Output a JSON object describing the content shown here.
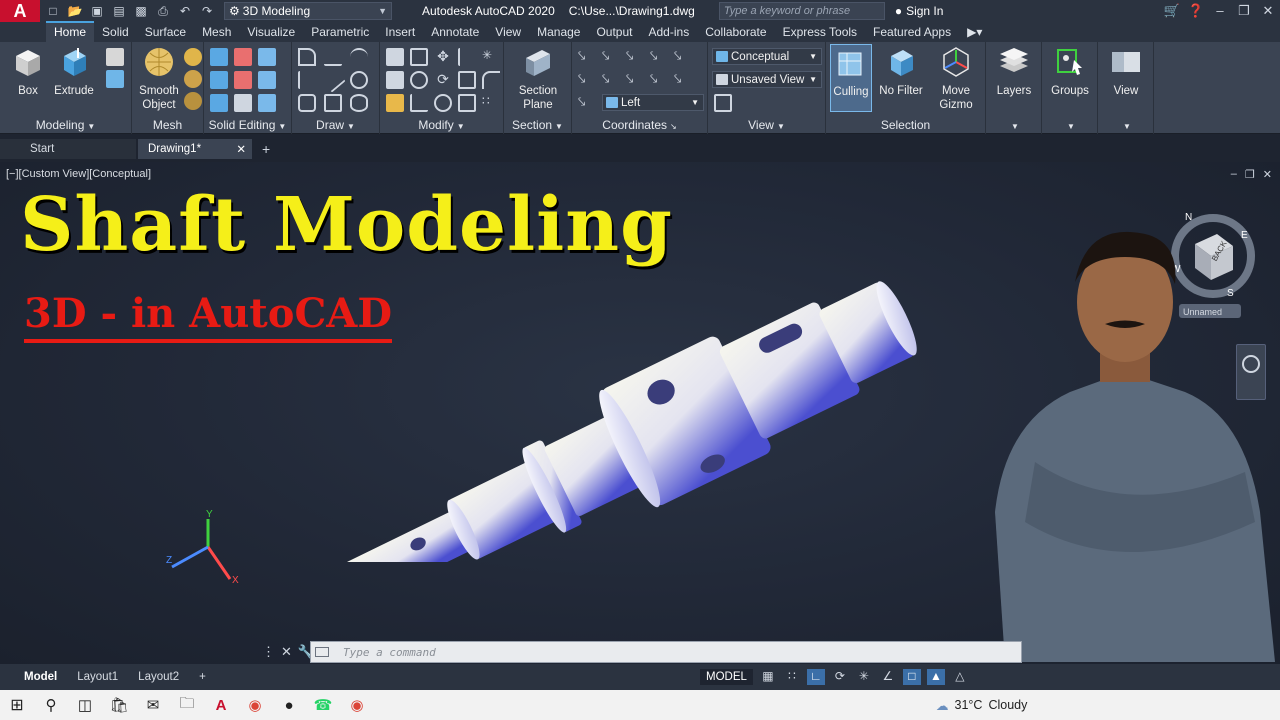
{
  "titlebar": {
    "logo": "A",
    "workspace": "3D Modeling",
    "app_title": "Autodesk AutoCAD 2020",
    "doc_path": "C:\\Use...\\Drawing1.dwg",
    "search_placeholder": "Type a keyword or phrase",
    "sign_in": "Sign In"
  },
  "ribbon_tabs": [
    "Home",
    "Solid",
    "Surface",
    "Mesh",
    "Visualize",
    "Parametric",
    "Insert",
    "Annotate",
    "View",
    "Manage",
    "Output",
    "Add-ins",
    "Collaborate",
    "Express Tools",
    "Featured Apps"
  ],
  "ribbon": {
    "modeling": {
      "title": "Modeling",
      "box": "Box",
      "extrude": "Extrude"
    },
    "mesh": {
      "title": "Mesh",
      "smooth_object": "Smooth Object"
    },
    "solid_editing": {
      "title": "Solid Editing"
    },
    "draw": {
      "title": "Draw"
    },
    "modify": {
      "title": "Modify"
    },
    "section": {
      "title": "Section",
      "section_plane": "Section Plane"
    },
    "coordinates": {
      "title": "Coordinates"
    },
    "view": {
      "title": "View",
      "visual_style": "Conceptual",
      "named_view": "Unsaved View",
      "direction": "Left"
    },
    "selection": {
      "title": "Selection",
      "culling": "Culling",
      "no_filter": "No Filter",
      "move_gizmo": "Move Gizmo"
    },
    "layers": {
      "label": "Layers"
    },
    "groups": {
      "label": "Groups"
    },
    "view_panel": {
      "label": "View"
    }
  },
  "file_tabs": [
    {
      "label": "Start",
      "active": false
    },
    {
      "label": "Drawing1*",
      "active": true
    }
  ],
  "viewport": {
    "view_label": "[−][Custom View][Conceptual]",
    "headline": "Shaft Modeling",
    "subhead": "3D - in AutoCAD",
    "viewcube": {
      "north": "N",
      "east": "E",
      "south": "S",
      "west": "W",
      "face": "BACK",
      "ucs_label": "Unnamed"
    },
    "ucs": {
      "x": "X",
      "y": "Y",
      "z": "Z"
    }
  },
  "command_line": {
    "placeholder": "Type a command"
  },
  "layout_tabs": [
    "Model",
    "Layout1",
    "Layout2"
  ],
  "status": {
    "model": "MODEL"
  },
  "taskbar": {
    "temperature": "31°C",
    "weather": "Cloudy"
  },
  "colors": {
    "accent": "#4aa3df",
    "headline": "#f5ef19",
    "subhead": "#e81b14",
    "ribbon": "#3b4453",
    "viewport": "#212837"
  }
}
